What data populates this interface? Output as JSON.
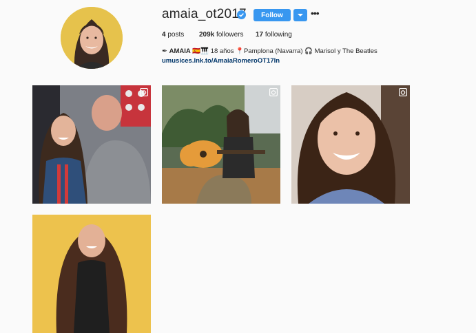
{
  "profile": {
    "username": "amaia_ot2017",
    "follow_label": "Follow",
    "more_label": "•••",
    "stats": {
      "posts_count": "4",
      "posts_label": "posts",
      "followers_count": "209k",
      "followers_label": "followers",
      "following_count": "17",
      "following_label": "following"
    },
    "bio": {
      "name": "AMAIA",
      "text": "🇪🇸🎹 18 años 📍Pamplona (Navarra) 🎧 Marisol y The Beatles",
      "pen_icon": "✒",
      "link": "umusices.lnk.to/AmaiaRomeroOT17In"
    }
  },
  "colors": {
    "background": "#fafafa",
    "follow_blue": "#3897f0",
    "link_blue": "#003569",
    "verified_blue": "#3897f0"
  },
  "posts": [
    {
      "type": "video",
      "icon": "video-icon"
    },
    {
      "type": "video",
      "icon": "video-icon"
    },
    {
      "type": "video",
      "icon": "video-icon"
    },
    {
      "type": "image"
    }
  ]
}
